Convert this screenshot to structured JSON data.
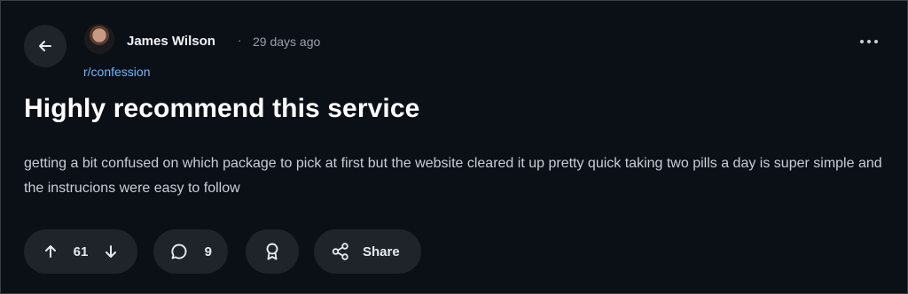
{
  "post": {
    "author": "James Wilson",
    "separator": "·",
    "time": "29 days ago",
    "subreddit": "r/confession",
    "title": "Highly recommend this service",
    "body": "getting a bit confused on which package to pick at first but the website cleared it up pretty quick taking two pills a day is super simple and the instrucions were easy to follow"
  },
  "actions": {
    "score": "61",
    "comments": "9",
    "share_label": "Share"
  },
  "icons": {
    "back": "arrow-left-icon",
    "more": "more-horizontal-icon",
    "upvote": "arrow-up-icon",
    "downvote": "arrow-down-icon",
    "comment": "comment-icon",
    "award": "award-icon",
    "share": "share-icon"
  },
  "colors": {
    "background": "#0b0f16",
    "surface": "#1f242b",
    "link": "#6fb6ff",
    "text": "#e7eaee"
  }
}
